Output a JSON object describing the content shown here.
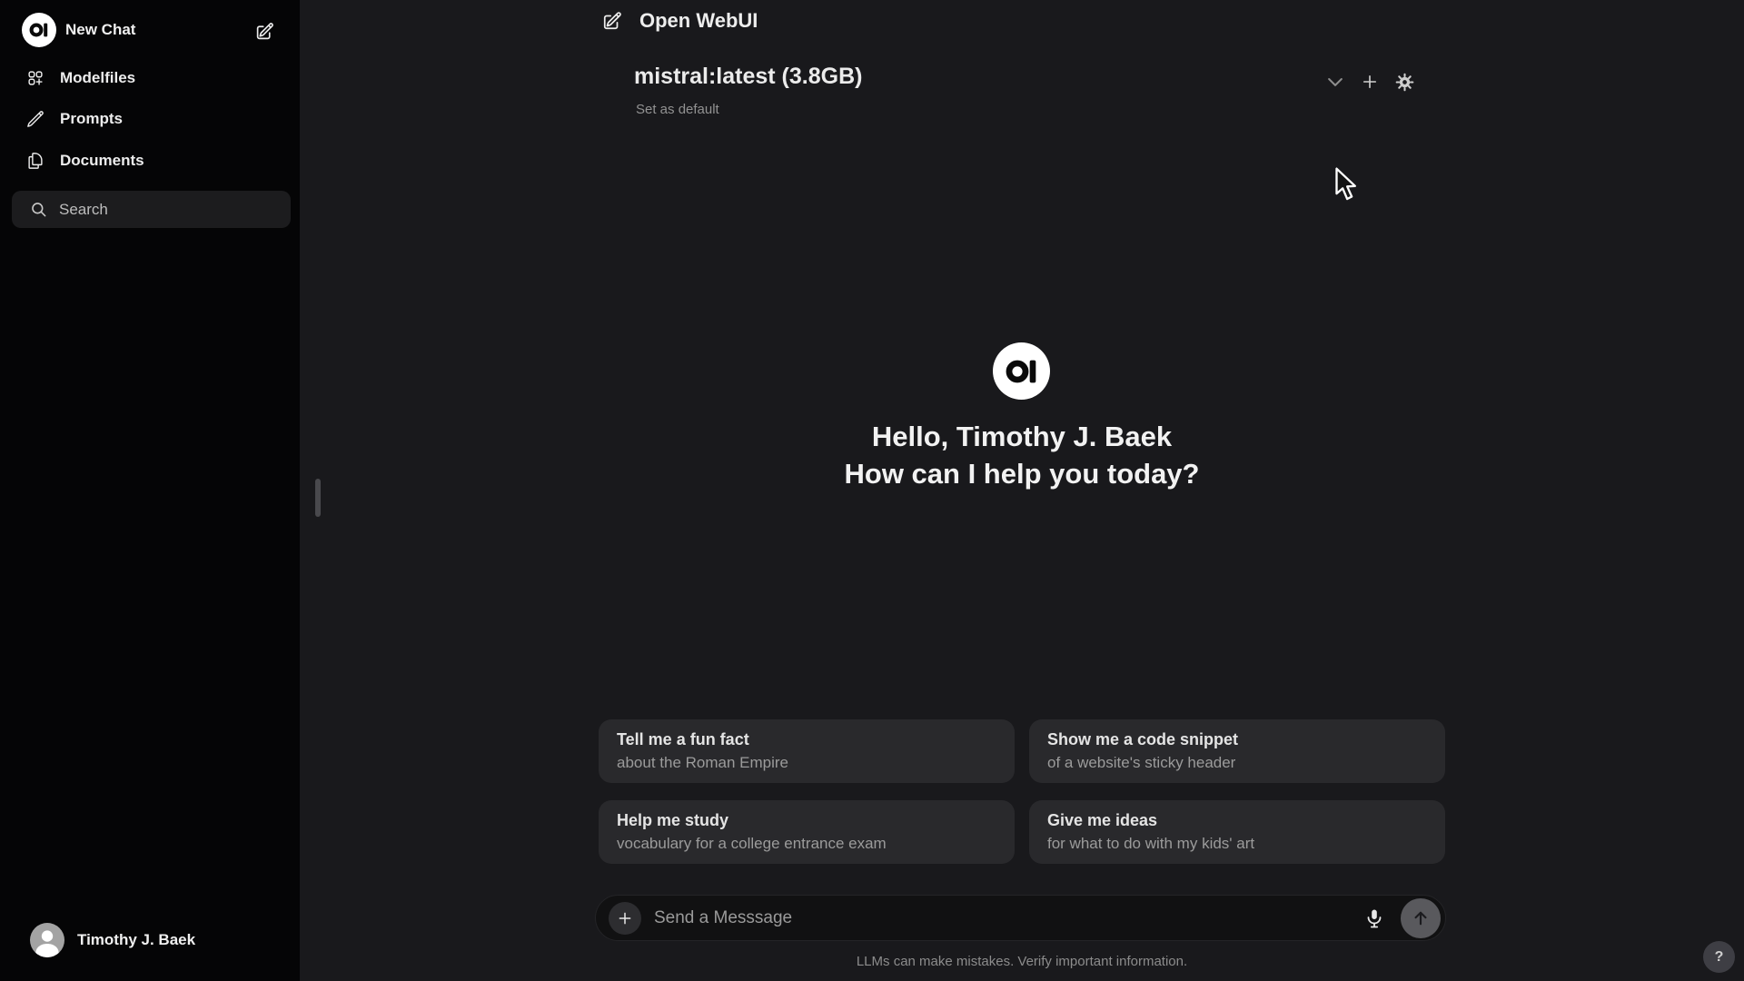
{
  "app": {
    "title": "Open WebUI"
  },
  "sidebar": {
    "new_chat_label": "New Chat",
    "items": [
      {
        "label": "Modelfiles",
        "icon": "squares-plus-icon"
      },
      {
        "label": "Prompts",
        "icon": "pencil-icon"
      },
      {
        "label": "Documents",
        "icon": "document-duplicate-icon"
      }
    ],
    "search": {
      "placeholder": "Search"
    },
    "user": {
      "name": "Timothy J. Baek"
    }
  },
  "model": {
    "name": "mistral:latest (3.8GB)",
    "set_default_label": "Set as default",
    "tools": [
      "chevron-down-icon",
      "plus-icon",
      "gear-icon"
    ]
  },
  "hero": {
    "greeting_line1": "Hello, Timothy J. Baek",
    "greeting_line2": "How can I help you today?"
  },
  "suggestions": [
    {
      "title": "Tell me a fun fact",
      "subtitle": "about the Roman Empire"
    },
    {
      "title": "Show me a code snippet",
      "subtitle": "of a website's sticky header"
    },
    {
      "title": "Help me study",
      "subtitle": "vocabulary for a college entrance exam"
    },
    {
      "title": "Give me ideas",
      "subtitle": "for what to do with my kids' art"
    }
  ],
  "composer": {
    "placeholder": "Send a Messsage"
  },
  "footer": {
    "disclaimer": "LLMs can make mistakes. Verify important information."
  },
  "help": {
    "label": "?"
  },
  "colors": {
    "sidebar_bg": "#050506",
    "main_bg": "#19191c",
    "card_bg": "#29292c",
    "search_bg": "#1c1c1e",
    "text_primary": "#ececec",
    "text_muted": "#9b9b9b"
  }
}
